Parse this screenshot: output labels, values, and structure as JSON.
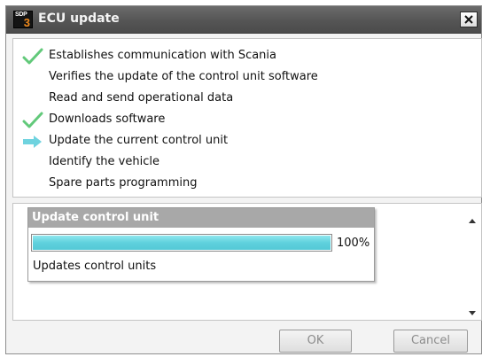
{
  "window": {
    "title": "ECU update",
    "logo_text": "SDP",
    "logo_number": "3"
  },
  "steps": [
    {
      "label": "Establishes communication with Scania",
      "status": "done",
      "icon": "check-icon"
    },
    {
      "label": "Verifies the update of the control unit software",
      "status": "pending",
      "icon": ""
    },
    {
      "label": "Read and send operational data",
      "status": "pending",
      "icon": ""
    },
    {
      "label": "Downloads software",
      "status": "done",
      "icon": "check-icon"
    },
    {
      "label": "Update the current control unit",
      "status": "current",
      "icon": "arrow-right-icon"
    },
    {
      "label": "Identify the vehicle",
      "status": "pending",
      "icon": ""
    },
    {
      "label": "Spare parts programming",
      "status": "pending",
      "icon": ""
    }
  ],
  "progress": {
    "title": "Update control unit",
    "percent_text": "100%",
    "fraction": 1.0,
    "status_text": "Updates control units"
  },
  "buttons": {
    "ok": "OK",
    "cancel": "Cancel"
  },
  "colors": {
    "check": "#62c97a",
    "arrow": "#6fd3df",
    "progress_fill": "#5fd1dd",
    "title_bar": "#555555"
  }
}
